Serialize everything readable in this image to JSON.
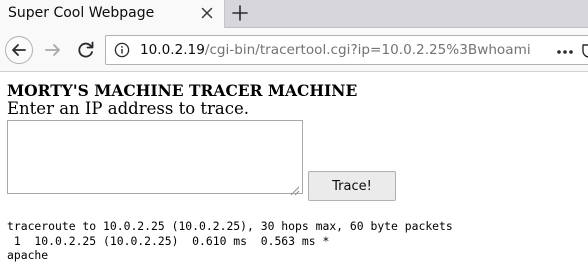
{
  "browser": {
    "tab": {
      "title": "Super Cool Webpage"
    },
    "url": {
      "host": "10.0.2.19",
      "path": "/cgi-bin/tracertool.cgi?ip=10.0.2.25%3Bwhoami"
    },
    "icons": {
      "close_tab": "close-icon",
      "new_tab": "plus-icon",
      "back": "arrow-left-icon",
      "forward": "arrow-right-icon",
      "reload": "reload-icon",
      "site_info": "info-icon",
      "page_actions": "more-icon",
      "pocket": "pocket-icon"
    }
  },
  "page": {
    "heading": "MORTY'S MACHINE TRACER MACHINE",
    "subtitle": "Enter an IP address to trace.",
    "ip_input": {
      "value": ""
    },
    "trace_button": "Trace!",
    "output": [
      "traceroute to 10.0.2.25 (10.0.2.25), 30 hops max, 60 byte packets",
      " 1  10.0.2.25 (10.0.2.25)  0.610 ms  0.563 ms *",
      "apache"
    ]
  },
  "colors": {
    "tabbar_bg": "#d7d7db",
    "toolbar_bg": "#f9f9fa",
    "button_bg": "#ebebeb",
    "url_host": "#0c0c0d",
    "url_path": "#737373"
  }
}
